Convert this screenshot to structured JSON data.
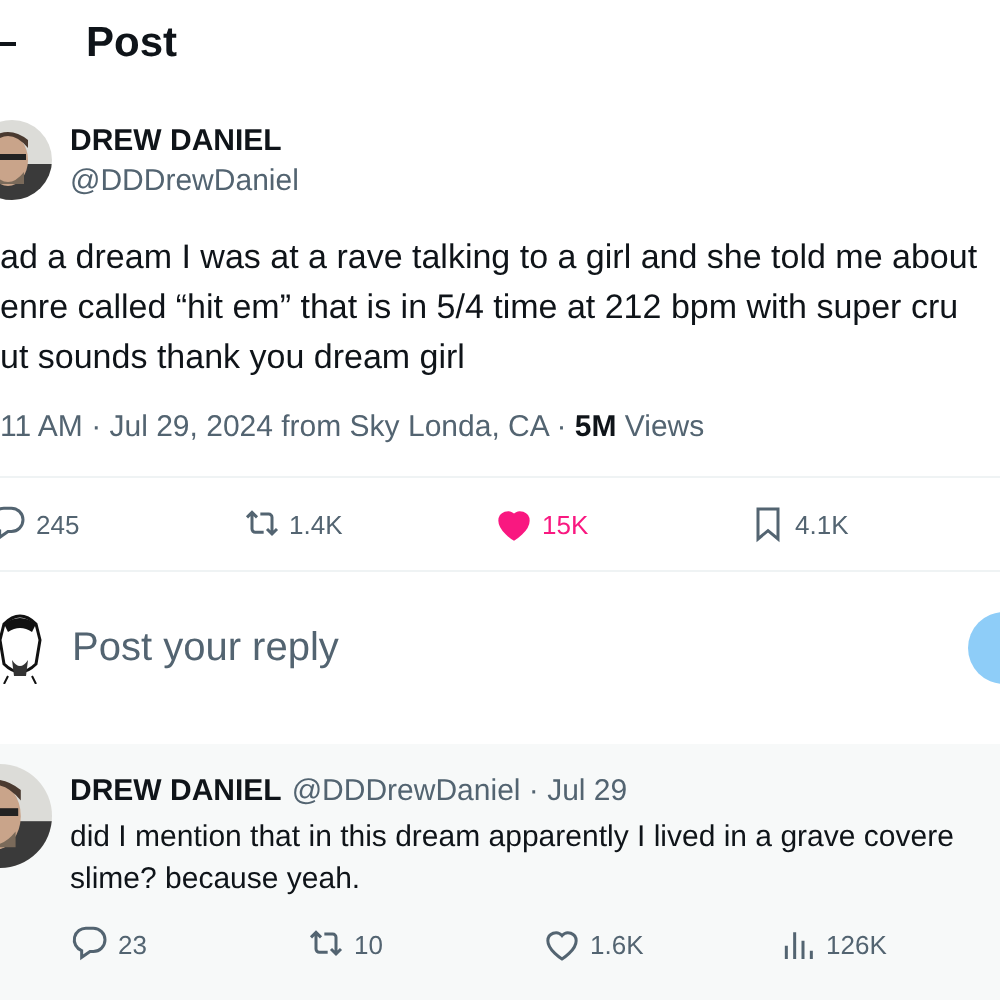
{
  "header": {
    "title": "Post"
  },
  "post": {
    "name": "DREW DANIEL",
    "handle": "@DDDrewDaniel",
    "text_lines": [
      "ad a dream I was at a rave talking to a girl and she told me about",
      "enre called “hit em” that is in 5/4 time at 212 bpm with super cru",
      "ut sounds thank you dream girl"
    ],
    "meta": {
      "time_place": "11 AM · Jul 29, 2024 from Sky Londa, CA · ",
      "views_count": "5M",
      "views_label": " Views"
    },
    "stats": [
      {
        "kind": "reply",
        "count": "245",
        "liked": false
      },
      {
        "kind": "repost",
        "count": "1.4K",
        "liked": false
      },
      {
        "kind": "like",
        "count": "15K",
        "liked": true
      },
      {
        "kind": "bookmark",
        "count": "4.1K",
        "liked": false
      }
    ]
  },
  "composer": {
    "placeholder": "Post your reply"
  },
  "reply": {
    "name": "DREW DANIEL",
    "handle": "@DDDrewDaniel",
    "date": " · Jul 29",
    "text_lines": [
      "did I mention that in this dream apparently I lived in a grave covere",
      "slime? because yeah."
    ],
    "stats": [
      {
        "kind": "reply",
        "count": "23",
        "liked": false
      },
      {
        "kind": "repost",
        "count": "10",
        "liked": false
      },
      {
        "kind": "like",
        "count": "1.6K",
        "liked": false
      },
      {
        "kind": "views",
        "count": "126K",
        "liked": false
      }
    ]
  }
}
